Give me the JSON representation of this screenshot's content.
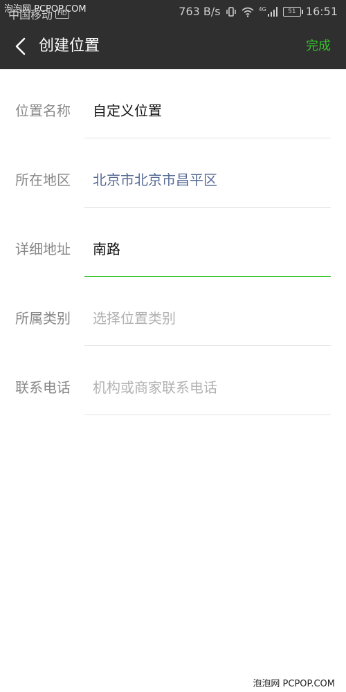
{
  "watermark": {
    "top": "泡泡网 PCPOP.COM",
    "bottom": "泡泡网 PCPOP.COM"
  },
  "status_bar": {
    "carrier": "中国移动",
    "carrier_badge": "HD",
    "network_speed": "763 B/s",
    "network_type": "4G",
    "battery_level": "51",
    "time": "16:51"
  },
  "header": {
    "title": "创建位置",
    "done_label": "完成"
  },
  "form": {
    "rows": [
      {
        "label": "位置名称",
        "value": "自定义位置"
      },
      {
        "label": "所在地区",
        "value": "北京市北京市昌平区"
      },
      {
        "label": "详细地址",
        "value": "南路"
      },
      {
        "label": "所属类别",
        "placeholder": "选择位置类别"
      },
      {
        "label": "联系电话",
        "placeholder": "机构或商家联系电话"
      }
    ]
  },
  "colors": {
    "bar_background": "#2f2f2f",
    "accent_green": "#35c12b",
    "link_blue": "#576b95",
    "label_gray": "#888888",
    "placeholder_gray": "#b2b2b2"
  }
}
